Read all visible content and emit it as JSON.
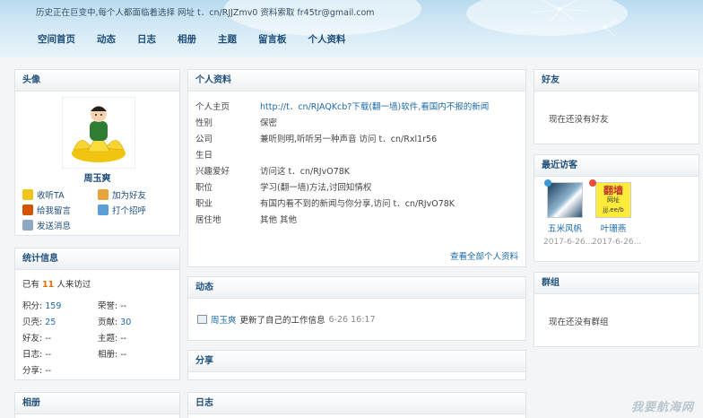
{
  "header": {
    "toptext": "历史正在巨变中,每个人都面临着选择 网址 t．cn/RJJZmv0 资料索取 fr45tr@gmail.com",
    "nav": [
      "空间首页",
      "动态",
      "日志",
      "相册",
      "主题",
      "留言板",
      "个人资料"
    ]
  },
  "avatar_panel": {
    "title": "头像",
    "name": "周玉爽",
    "actions": [
      "收听TA",
      "加为好友",
      "给我留言",
      "打个招呼",
      "发送消息"
    ]
  },
  "stats_panel": {
    "title": "统计信息",
    "visits_prefix": "已有",
    "visits_count": "11",
    "visits_suffix": "人来访过",
    "rows": [
      {
        "k1": "积分:",
        "v1": "159",
        "k2": "荣誉:",
        "v2": "--"
      },
      {
        "k1": "贝壳:",
        "v1": "25",
        "k2": "贡献:",
        "v2": "30"
      },
      {
        "k1": "好友:",
        "v1": "--",
        "k2": "主题:",
        "v2": "--"
      },
      {
        "k1": "日志:",
        "v1": "--",
        "k2": "相册:",
        "v2": "--"
      },
      {
        "k1": "分享:",
        "v1": "--",
        "k2": "",
        "v2": ""
      }
    ]
  },
  "album_panel": {
    "title": "相册"
  },
  "profile_panel": {
    "title": "个人资料",
    "rows": [
      {
        "k": "个人主页",
        "v": "http://t．cn/RJAQKcb?下载(翻一墙)软件,看国内不报的新闻",
        "link": true
      },
      {
        "k": "性别",
        "v": "保密"
      },
      {
        "k": "公司",
        "v": "兼听则明,听听另一种声音 访问 t．cn/Rxl1r56"
      },
      {
        "k": "生日",
        "v": ""
      },
      {
        "k": "兴趣爱好",
        "v": "访问这 t．cn/RJvO78K"
      },
      {
        "k": "职位",
        "v": "学习(翻一墙)方法,讨回知情权"
      },
      {
        "k": "职业",
        "v": "有国内看不到的新闻与你分享,访问 t．cn/RJvO78K"
      },
      {
        "k": "居住地",
        "v": "其他 其他"
      }
    ],
    "more": "查看全部个人资料"
  },
  "feed_panel": {
    "title": "动态",
    "user": "周玉爽",
    "action": "更新了自己的工作信息",
    "time": "6-26 16:17"
  },
  "share_panel": {
    "title": "分享"
  },
  "blog_panel": {
    "title": "日志"
  },
  "friends_panel": {
    "title": "好友",
    "empty": "现在还没有好友"
  },
  "visitors_panel": {
    "title": "最近访客",
    "visitors": [
      {
        "name": "五米风帆",
        "date": "2017-6-26..."
      },
      {
        "name": "叶珊燕",
        "date": "2017-6-26..."
      }
    ],
    "thumb2_text1": "翻墙",
    "thumb2_text2": "网址",
    "thumb2_text3": "jjj.ee/b"
  },
  "groups_panel": {
    "title": "群组",
    "empty": "现在还没有群组"
  },
  "watermark": "我要航海网",
  "colors": {
    "link": "#1d6aa8",
    "title": "#1f4f7a",
    "accent": "#e46c0a"
  }
}
